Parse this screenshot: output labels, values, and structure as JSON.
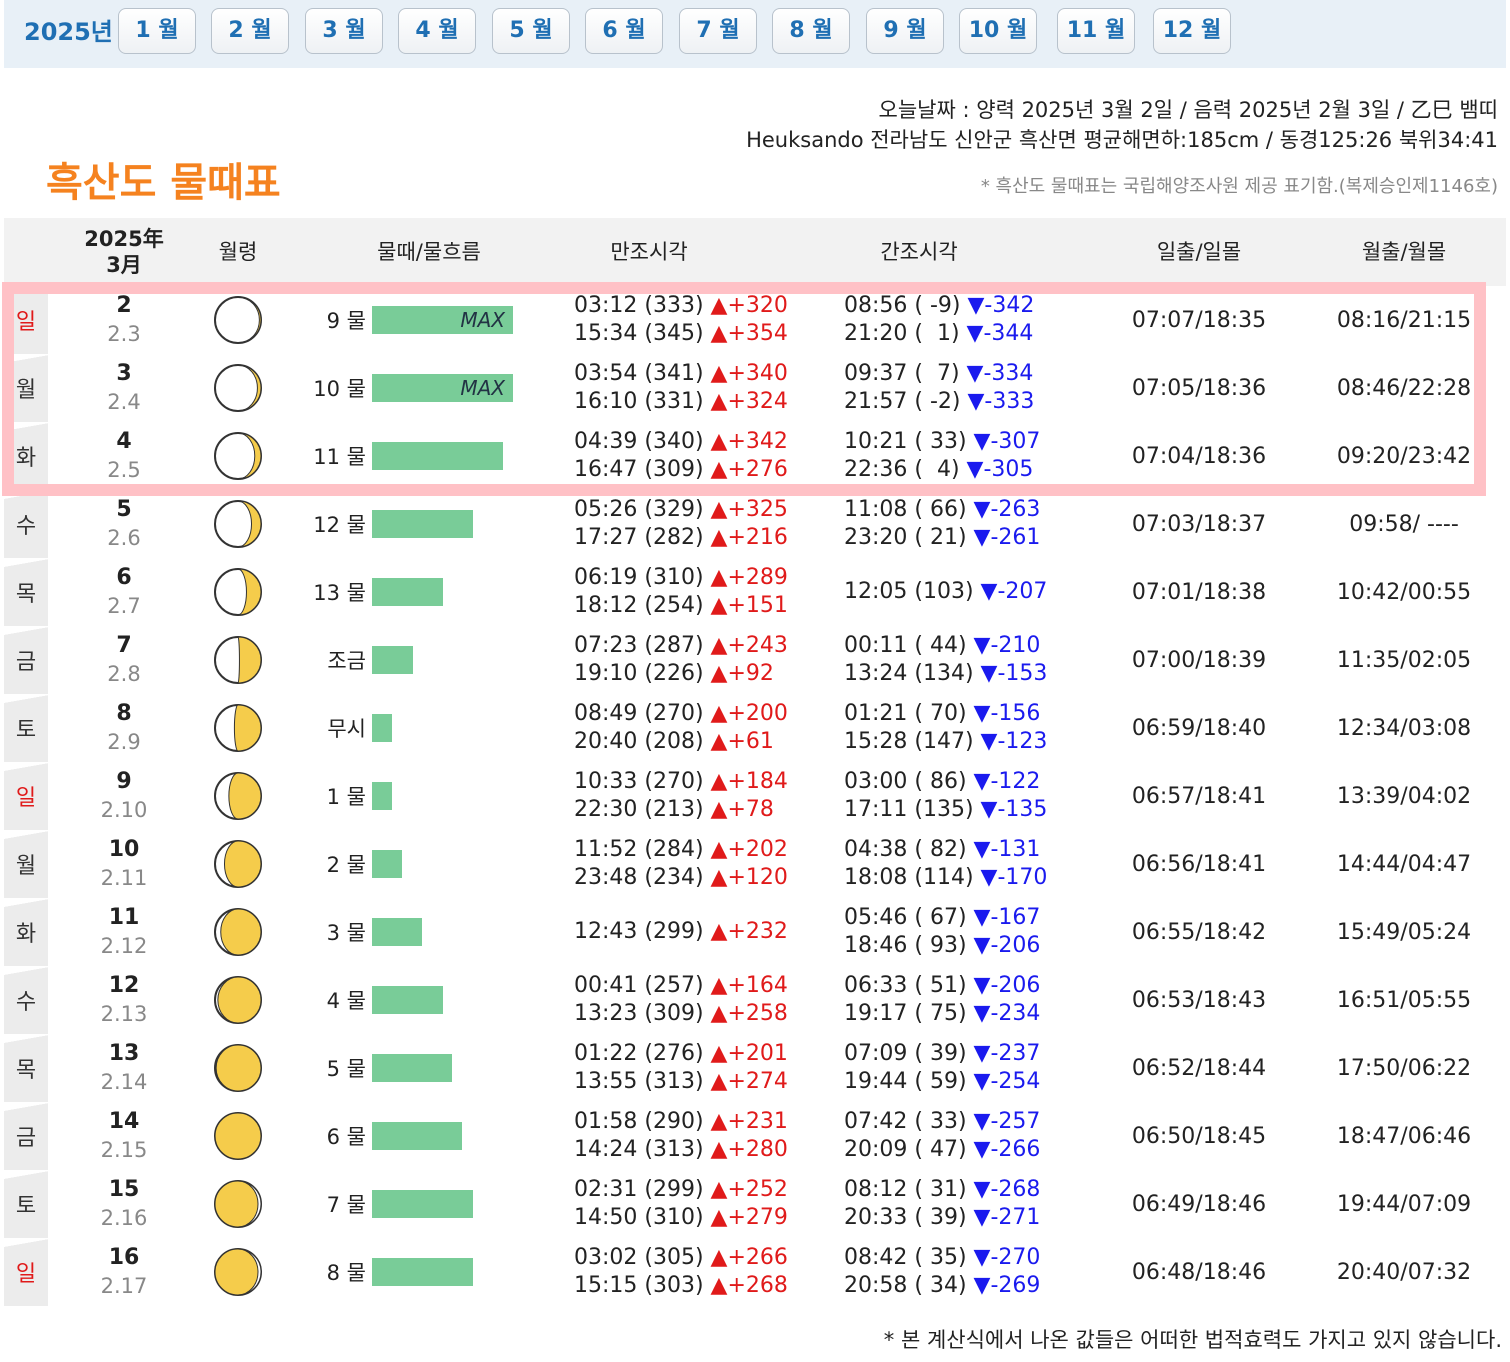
{
  "nav": {
    "year": "2025년",
    "months": [
      "1 월",
      "2 월",
      "3 월",
      "4 월",
      "5 월",
      "6 월",
      "7 월",
      "8 월",
      "9 월",
      "10 월",
      "11 월",
      "12 월"
    ]
  },
  "info": {
    "today": "오늘날짜 : 양력 2025년 3월 2일 / 음력 2025년 2월 3일 / 乙巳 뱀띠",
    "location": "Heuksando 전라남도 신안군 흑산면 평균해면하:185cm / 동경125:26 북위34:41",
    "notice": "* 흑산도 물때표는 국립해양조사원 제공 표기함.(복제승인제1146호)"
  },
  "title": "흑산도 물때표",
  "headers": {
    "date_line1": "2025年",
    "date_line2": "3月",
    "moon_age": "월령",
    "tide": "물때/물흐름",
    "high": "만조시각",
    "low": "간조시각",
    "sun": "일출/일몰",
    "moon": "월출/월몰"
  },
  "max_label": "MAX",
  "rows": [
    {
      "dow": "일",
      "sunday": true,
      "day": "2",
      "lunar": "2.3",
      "phase": 0.12,
      "tide": "9 물",
      "flow": 0.94,
      "max": true,
      "hw1": "03:12 (333) ",
      "hw1d": "▲+320",
      "hw2": "15:34 (345) ",
      "hw2d": "▲+354",
      "lw1": "08:56 ( -9) ",
      "lw1d": "▼-342",
      "lw2": "21:20 (  1) ",
      "lw2d": "▼-344",
      "sun": "07:07/18:35",
      "moon": "08:16/21:15"
    },
    {
      "dow": "월",
      "sunday": false,
      "day": "3",
      "lunar": "2.4",
      "phase": 0.18,
      "tide": "10 물",
      "flow": 0.94,
      "max": true,
      "hw1": "03:54 (341) ",
      "hw1d": "▲+340",
      "hw2": "16:10 (331) ",
      "hw2d": "▲+324",
      "lw1": "09:37 (  7) ",
      "lw1d": "▼-334",
      "lw2": "21:57 ( -2) ",
      "lw2d": "▼-333",
      "sun": "07:05/18:36",
      "moon": "08:46/22:28"
    },
    {
      "dow": "화",
      "sunday": false,
      "day": "4",
      "lunar": "2.5",
      "phase": 0.24,
      "tide": "11 물",
      "flow": 0.87,
      "max": false,
      "hw1": "04:39 (340) ",
      "hw1d": "▲+342",
      "hw2": "16:47 (309) ",
      "hw2d": "▲+276",
      "lw1": "10:21 ( 33) ",
      "lw1d": "▼-307",
      "lw2": "22:36 (  4) ",
      "lw2d": "▼-305",
      "sun": "07:04/18:36",
      "moon": "09:20/23:42"
    },
    {
      "dow": "수",
      "sunday": false,
      "day": "5",
      "lunar": "2.6",
      "phase": 0.3,
      "tide": "12 물",
      "flow": 0.67,
      "max": false,
      "hw1": "05:26 (329) ",
      "hw1d": "▲+325",
      "hw2": "17:27 (282) ",
      "hw2d": "▲+216",
      "lw1": "11:08 ( 66) ",
      "lw1d": "▼-263",
      "lw2": "23:20 ( 21) ",
      "lw2d": "▼-261",
      "sun": "07:03/18:37",
      "moon": "09:58/ ----"
    },
    {
      "dow": "목",
      "sunday": false,
      "day": "6",
      "lunar": "2.7",
      "phase": 0.38,
      "tide": "13 물",
      "flow": 0.47,
      "max": false,
      "hw1": "06:19 (310) ",
      "hw1d": "▲+289",
      "hw2": "18:12 (254) ",
      "hw2d": "▲+151",
      "lw1": "12:05 (103) ",
      "lw1d": "▼-207",
      "lw2": "",
      "lw2d": "",
      "sun": "07:01/18:38",
      "moon": "10:42/00:55"
    },
    {
      "dow": "금",
      "sunday": false,
      "day": "7",
      "lunar": "2.8",
      "phase": 0.48,
      "tide": "조금",
      "flow": 0.27,
      "max": false,
      "hw1": "07:23 (287) ",
      "hw1d": "▲+243",
      "hw2": "19:10 (226) ",
      "hw2d": "▲+92",
      "lw1": "00:11 ( 44) ",
      "lw1d": "▼-210",
      "lw2": "13:24 (134) ",
      "lw2d": "▼-153",
      "sun": "07:00/18:39",
      "moon": "11:35/02:05"
    },
    {
      "dow": "토",
      "sunday": false,
      "day": "8",
      "lunar": "2.9",
      "phase": 0.55,
      "tide": "무시",
      "flow": 0.13,
      "max": false,
      "hw1": "08:49 (270) ",
      "hw1d": "▲+200",
      "hw2": "20:40 (208) ",
      "hw2d": "▲+61",
      "lw1": "01:21 ( 70) ",
      "lw1d": "▼-156",
      "lw2": "15:28 (147) ",
      "lw2d": "▼-123",
      "sun": "06:59/18:40",
      "moon": "12:34/03:08"
    },
    {
      "dow": "일",
      "sunday": true,
      "day": "9",
      "lunar": "2.10",
      "phase": 0.63,
      "tide": "1 물",
      "flow": 0.13,
      "max": false,
      "hw1": "10:33 (270) ",
      "hw1d": "▲+184",
      "hw2": "22:30 (213) ",
      "hw2d": "▲+78",
      "lw1": "03:00 ( 86) ",
      "lw1d": "▼-122",
      "lw2": "17:11 (135) ",
      "lw2d": "▼-135",
      "sun": "06:57/18:41",
      "moon": "13:39/04:02"
    },
    {
      "dow": "월",
      "sunday": false,
      "day": "10",
      "lunar": "2.11",
      "phase": 0.7,
      "tide": "2 물",
      "flow": 0.2,
      "max": false,
      "hw1": "11:52 (284) ",
      "hw1d": "▲+202",
      "hw2": "23:48 (234) ",
      "hw2d": "▲+120",
      "lw1": "04:38 ( 82) ",
      "lw1d": "▼-131",
      "lw2": "18:08 (114) ",
      "lw2d": "▼-170",
      "sun": "06:56/18:41",
      "moon": "14:44/04:47"
    },
    {
      "dow": "화",
      "sunday": false,
      "day": "11",
      "lunar": "2.12",
      "phase": 0.77,
      "tide": "3 물",
      "flow": 0.33,
      "max": false,
      "hw1": "12:43 (299) ",
      "hw1d": "▲+232",
      "hw2": "",
      "hw2d": "",
      "lw1": "05:46 ( 67) ",
      "lw1d": "▼-167",
      "lw2": "18:46 ( 93) ",
      "lw2d": "▼-206",
      "sun": "06:55/18:42",
      "moon": "15:49/05:24"
    },
    {
      "dow": "수",
      "sunday": false,
      "day": "12",
      "lunar": "2.13",
      "phase": 0.84,
      "tide": "4 물",
      "flow": 0.47,
      "max": false,
      "hw1": "00:41 (257) ",
      "hw1d": "▲+164",
      "hw2": "13:23 (309) ",
      "hw2d": "▲+258",
      "lw1": "06:33 ( 51) ",
      "lw1d": "▼-206",
      "lw2": "19:17 ( 75) ",
      "lw2d": "▼-234",
      "sun": "06:53/18:43",
      "moon": "16:51/05:55"
    },
    {
      "dow": "목",
      "sunday": false,
      "day": "13",
      "lunar": "2.14",
      "phase": 0.9,
      "tide": "5 물",
      "flow": 0.53,
      "max": false,
      "hw1": "01:22 (276) ",
      "hw1d": "▲+201",
      "hw2": "13:55 (313) ",
      "hw2d": "▲+274",
      "lw1": "07:09 ( 39) ",
      "lw1d": "▼-237",
      "lw2": "19:44 ( 59) ",
      "lw2d": "▼-254",
      "sun": "06:52/18:44",
      "moon": "17:50/06:22"
    },
    {
      "dow": "금",
      "sunday": false,
      "day": "14",
      "lunar": "2.15",
      "phase": 0.98,
      "tide": "6 물",
      "flow": 0.6,
      "max": false,
      "hw1": "01:58 (290) ",
      "hw1d": "▲+231",
      "hw2": "14:24 (313) ",
      "hw2d": "▲+280",
      "lw1": "07:42 ( 33) ",
      "lw1d": "▼-257",
      "lw2": "20:09 ( 47) ",
      "lw2d": "▼-266",
      "sun": "06:50/18:45",
      "moon": "18:47/06:46"
    },
    {
      "dow": "토",
      "sunday": false,
      "day": "15",
      "lunar": "2.16",
      "phase": 1.04,
      "tide": "7 물",
      "flow": 0.67,
      "max": false,
      "hw1": "02:31 (299) ",
      "hw1d": "▲+252",
      "hw2": "14:50 (310) ",
      "hw2d": "▲+279",
      "lw1": "08:12 ( 31) ",
      "lw1d": "▼-268",
      "lw2": "20:33 ( 39) ",
      "lw2d": "▼-271",
      "sun": "06:49/18:46",
      "moon": "19:44/07:09"
    },
    {
      "dow": "일",
      "sunday": true,
      "day": "16",
      "lunar": "2.17",
      "phase": 1.08,
      "tide": "8 물",
      "flow": 0.67,
      "max": false,
      "hw1": "03:02 (305) ",
      "hw1d": "▲+266",
      "hw2": "15:15 (303) ",
      "hw2d": "▲+268",
      "lw1": "08:42 ( 35) ",
      "lw1d": "▼-270",
      "lw2": "20:58 ( 34) ",
      "lw2d": "▼-269",
      "sun": "06:48/18:46",
      "moon": "20:40/07:32"
    }
  ],
  "footer": "* 본 계산식에서 나온 값들은 어떠한 법적효력도 가지고 있지 않습니다."
}
